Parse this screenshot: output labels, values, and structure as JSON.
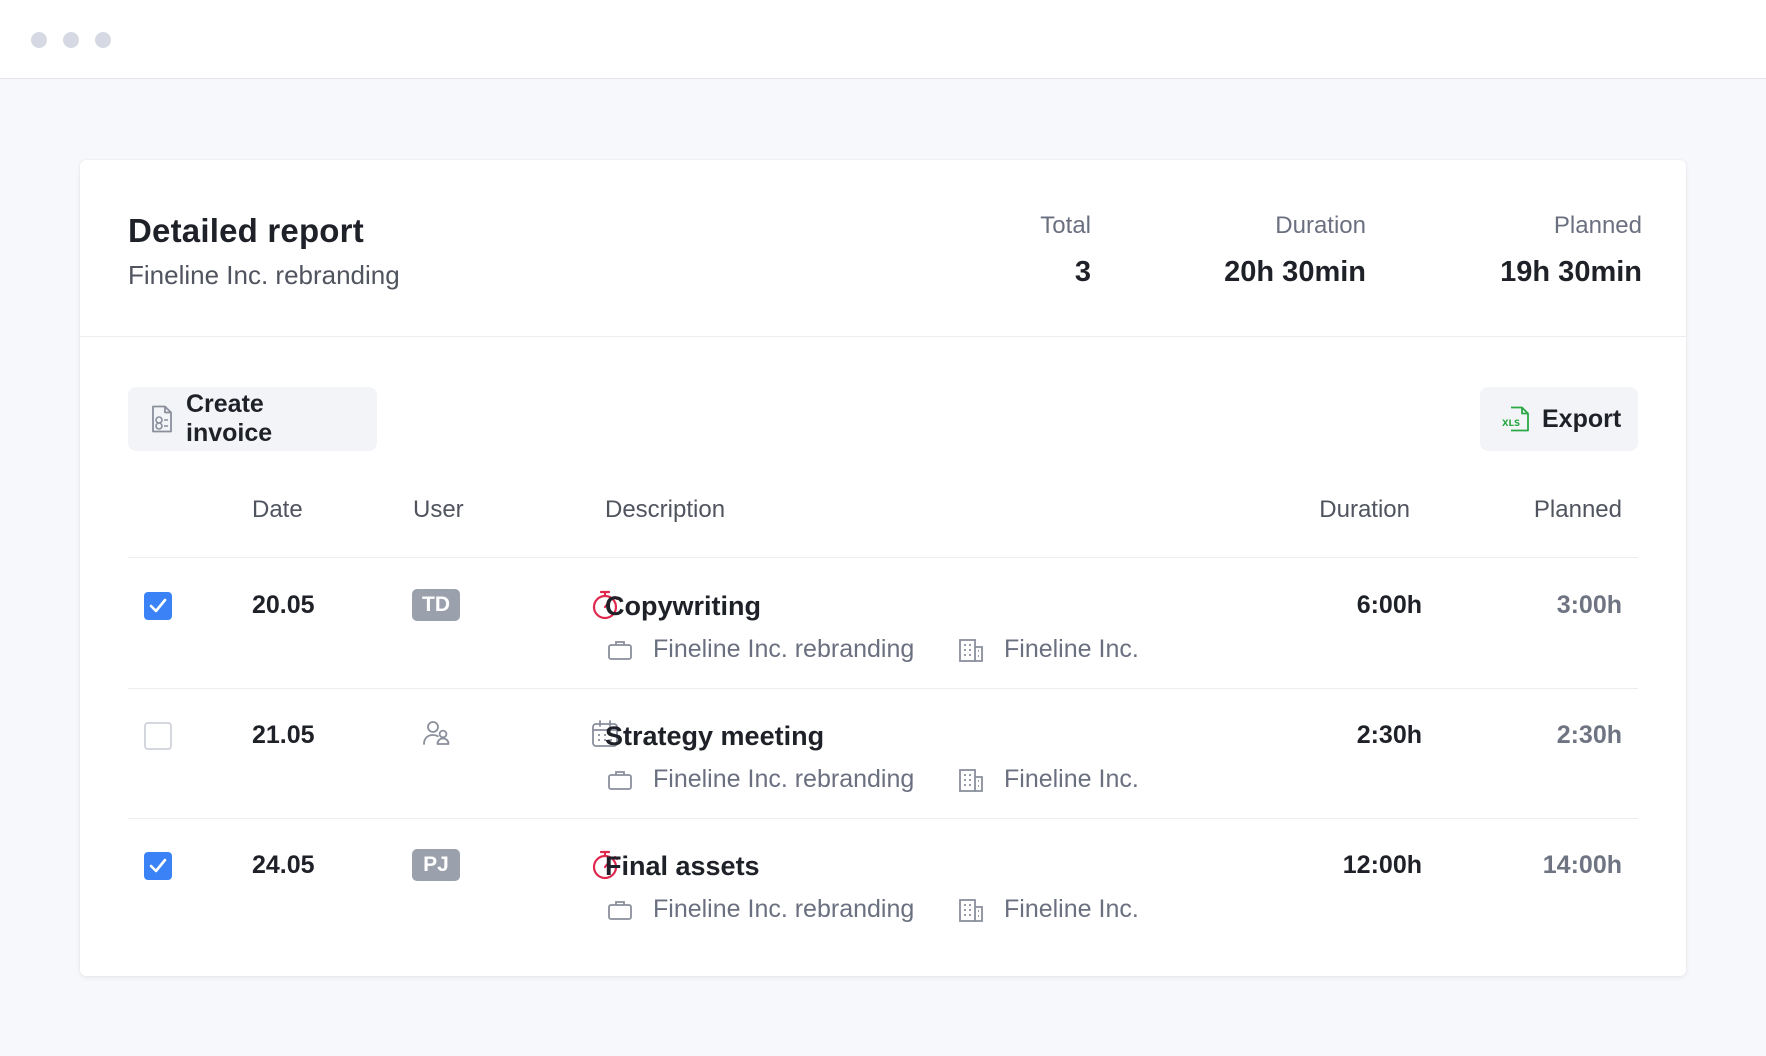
{
  "report": {
    "title": "Detailed report",
    "subtitle": "Fineline Inc. rebranding"
  },
  "stats": {
    "total_label": "Total",
    "total_value": "3",
    "duration_label": "Duration",
    "duration_value": "20h 30min",
    "planned_label": "Planned",
    "planned_value": "19h 30min"
  },
  "toolbar": {
    "create_invoice_label": "Create invoice",
    "export_label": "Export"
  },
  "table": {
    "headers": {
      "date": "Date",
      "user": "User",
      "description": "Description",
      "duration": "Duration",
      "planned": "Planned"
    },
    "rows": [
      {
        "checked": true,
        "date": "20.05",
        "user": "TD",
        "type_icon": "stopwatch-icon",
        "title": "Copywriting",
        "project": "Fineline Inc. rebranding",
        "client": "Fineline Inc.",
        "duration": "6:00h",
        "planned": "3:00h"
      },
      {
        "checked": false,
        "date": "21.05",
        "user": "",
        "type_icon": "calendar-icon",
        "title": "Strategy meeting",
        "project": "Fineline Inc. rebranding",
        "client": "Fineline Inc.",
        "duration": "2:30h",
        "planned": "2:30h"
      },
      {
        "checked": true,
        "date": "24.05",
        "user": "PJ",
        "type_icon": "stopwatch-icon",
        "title": "Final assets",
        "project": "Fineline Inc. rebranding",
        "client": "Fineline Inc.",
        "duration": "12:00h",
        "planned": "14:00h"
      }
    ]
  },
  "colors": {
    "accent": "#3b82f6",
    "timer": "#e0284f",
    "excel": "#2aa845",
    "muted": "#6b7080"
  }
}
